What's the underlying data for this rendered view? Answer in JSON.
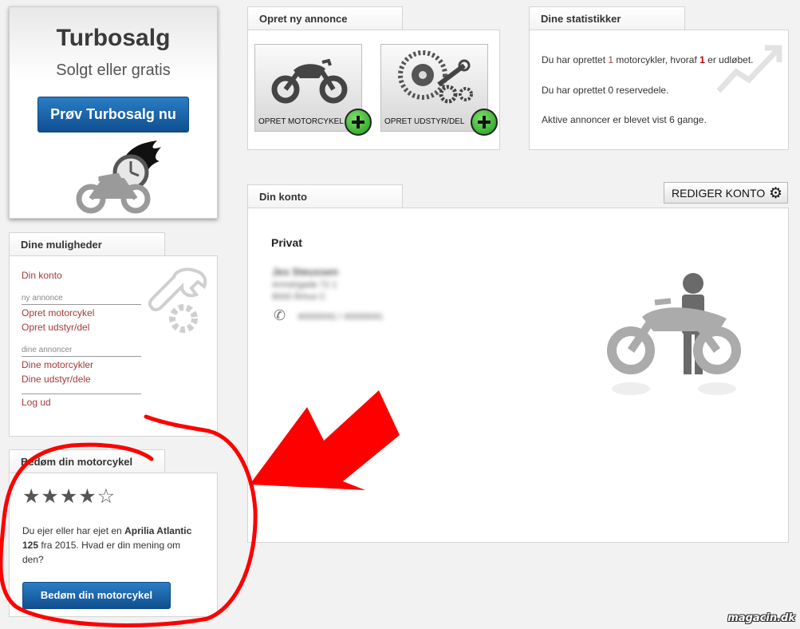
{
  "turbosalg": {
    "title": "Turbosalg",
    "subtitle": "Solgt eller gratis",
    "button": "Prøv Turbosalg nu"
  },
  "options": {
    "tab": "Dine muligheder",
    "my_account": "Din konto",
    "new_ad_caption": "ny annonce",
    "create_motorcycle": "Opret motorcykel",
    "create_gear": "Opret udstyr/del",
    "your_ads_caption": "dine annoncer",
    "your_motorcycles": "Dine motorcykler",
    "your_gear": "Dine udstyr/dele",
    "logout": "Log ud"
  },
  "rate": {
    "tab": "Bedøm din motorcykel",
    "rating": 4,
    "max": 5,
    "text_pre": "Du ejer eller har ejet en ",
    "model": "Aprilia Atlantic 125",
    "text_post": " fra 2015. Hvad er din mening om den?",
    "button": "Bedøm din motorcykel"
  },
  "create": {
    "tab": "Opret ny annonce",
    "motorcycle_label": "OPRET MOTORCYKEL",
    "gear_label": "OPRET UDSTYR/DEL"
  },
  "stats": {
    "tab": "Dine statistikker",
    "line1_pre": "Du har oprettet ",
    "line1_count": "1",
    "line1_mid": " motorcykler, hvoraf ",
    "line1_expired": "1",
    "line1_post": " er udløbet.",
    "line2": "Du har oprettet 0 reservedele.",
    "line3": "Aktive annoncer er blevet vist 6 gange."
  },
  "account": {
    "tab": "Din konto",
    "edit_button": "REDIGER KONTO",
    "type": "Privat",
    "name": "Jes Steussen",
    "address1": "Armstrgade 72 1",
    "address2": "8000 Århus C",
    "phones": "40000041   /   40000041"
  },
  "watermark": "magacin.dk",
  "colors": {
    "accent_blue": "#1a64a8",
    "link_red": "#a53a3a",
    "annotation_red": "#ff0000",
    "plus_green": "#3cbf2e"
  }
}
